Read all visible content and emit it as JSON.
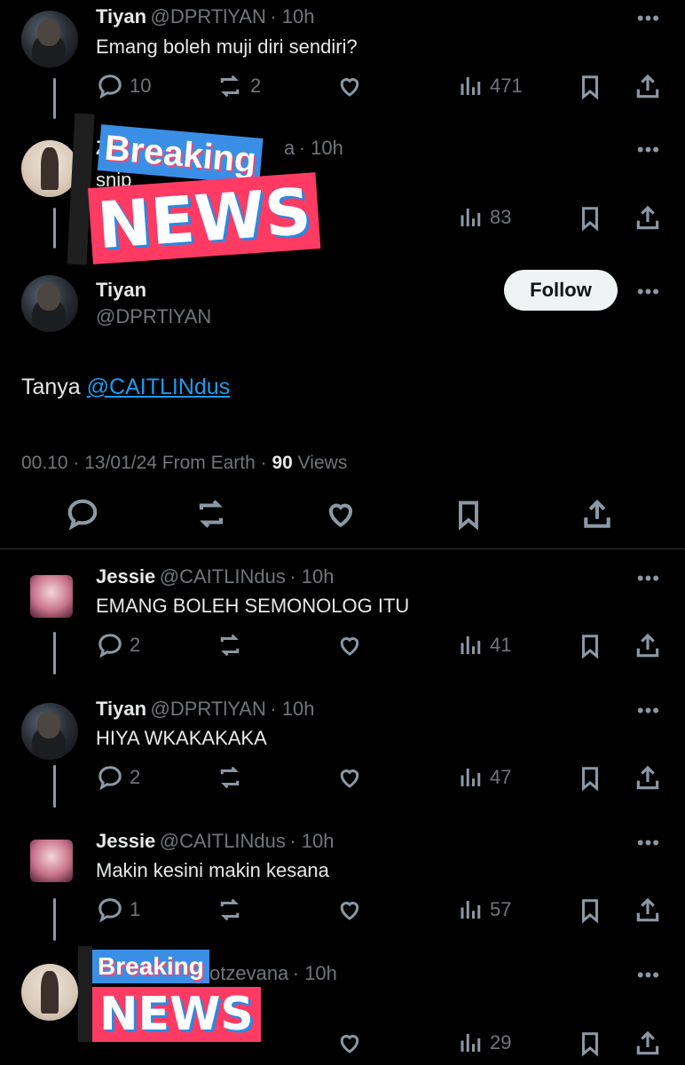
{
  "tweets": [
    {
      "name": "Tiyan",
      "handle": "@DPRTlYAN",
      "time": "· 10h",
      "text": "Emang boleh muji diri sendiri?",
      "replies": "10",
      "reposts": "2",
      "likes": "",
      "views": "471"
    },
    {
      "name": "Z",
      "handle": "a",
      "time": "· 10h",
      "text": "snip",
      "replies": "",
      "reposts": "",
      "likes": "",
      "views": "83"
    },
    {
      "name": "Jessie",
      "handle": "@CAITLINdus",
      "time": "· 10h",
      "text": "EMANG BOLEH SEMONOLOG ITU",
      "replies": "2",
      "reposts": "",
      "likes": "",
      "views": "41"
    },
    {
      "name": "Tiyan",
      "handle": "@DPRTlYAN",
      "time": "· 10h",
      "text": "HIYA WKAKAKAKA",
      "replies": "2",
      "reposts": "",
      "likes": "",
      "views": "47"
    },
    {
      "name": "Jessie",
      "handle": "@CAITLINdus",
      "time": "· 10h",
      "text": "Makin kesini makin kesana",
      "replies": "1",
      "reposts": "",
      "likes": "",
      "views": "57"
    },
    {
      "name": "",
      "handle": "otzevana",
      "time": "· 10h",
      "text": "",
      "replies": "",
      "reposts": "",
      "likes": "",
      "views": "29"
    }
  ],
  "main_tweet": {
    "name": "Tiyan",
    "handle": "@DPRTlYAN",
    "follow_label": "Follow",
    "text_prefix": "Tanya ",
    "mention": "@CAITLINdus",
    "timestamp": "00.10 · 13/01/24 From Earth · ",
    "views_count": "90",
    "views_label": " Views"
  },
  "stickers": [
    {
      "top": "Breaking",
      "bottom": "NEWS"
    },
    {
      "top": "Breaking",
      "bottom": "NEWS"
    }
  ],
  "more_label": "•••",
  "colors": {
    "background": "#000000",
    "text": "#e7e9ea",
    "muted": "#71767b",
    "link": "#1d9bf0",
    "sticker_blue": "#3a8ee6",
    "sticker_pink": "#ff3b63"
  }
}
